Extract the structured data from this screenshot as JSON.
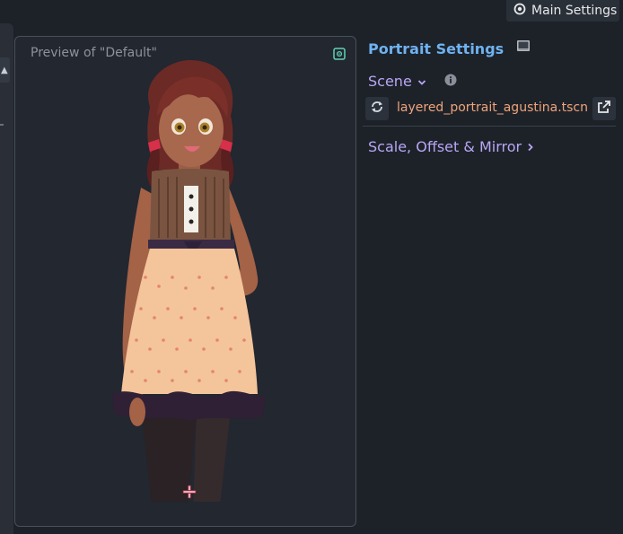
{
  "top_bar": {
    "main_settings_label": "Main Settings",
    "main_settings_icon": "eye-icon"
  },
  "preview": {
    "label": "Preview of \"Default\"",
    "fit_icon": "fit-view-icon",
    "origin_icon": "origin-cross-icon",
    "portrait": "anime-girl-portrait"
  },
  "settings": {
    "title": "Portrait Settings",
    "title_icon": "display-icon",
    "scene": {
      "label": "Scene",
      "expand_icon": "chevron-down-icon",
      "info_icon": "info-icon",
      "file_name": "layered_portrait_agustina.tscn",
      "reload_icon": "reload-icon",
      "open_icon": "open-external-icon"
    },
    "scale_section": {
      "label": "Scale, Offset & Mirror",
      "expand_icon": "chevron-right-icon"
    }
  },
  "colors": {
    "background": "#1d2229",
    "title_blue": "#6fb2f0",
    "section_purple": "#b8a6f5",
    "file_orange": "#f0a37a"
  }
}
